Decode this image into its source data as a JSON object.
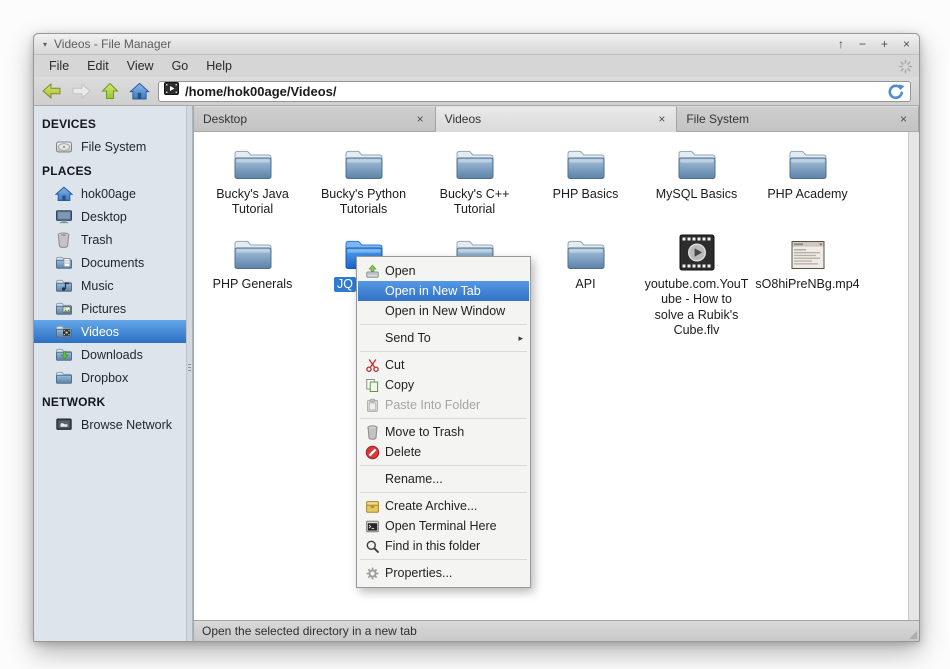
{
  "window": {
    "title": "Videos - File Manager",
    "controls": [
      {
        "name": "roll-up",
        "glyph": "↑"
      },
      {
        "name": "minimize",
        "glyph": "−"
      },
      {
        "name": "maximize",
        "glyph": "+"
      },
      {
        "name": "close",
        "glyph": "×"
      }
    ],
    "title_dropdown_glyph": "▾"
  },
  "menubar": {
    "items": [
      "File",
      "Edit",
      "View",
      "Go",
      "Help"
    ]
  },
  "toolbar": {
    "path": "/home/hok00age/Videos/"
  },
  "tabs": [
    {
      "label": "Desktop",
      "active": false,
      "close_glyph": "×"
    },
    {
      "label": "Videos",
      "active": true,
      "close_glyph": "×"
    },
    {
      "label": "File System",
      "active": false,
      "close_glyph": "×"
    }
  ],
  "sidebar": {
    "sections": [
      {
        "header": "DEVICES",
        "items": [
          {
            "label": "File System",
            "icon": "drive-icon"
          }
        ]
      },
      {
        "header": "PLACES",
        "items": [
          {
            "label": "hok00age",
            "icon": "home-icon"
          },
          {
            "label": "Desktop",
            "icon": "desktop-icon"
          },
          {
            "label": "Trash",
            "icon": "trash-icon"
          },
          {
            "label": "Documents",
            "icon": "documents-folder-icon"
          },
          {
            "label": "Music",
            "icon": "music-folder-icon"
          },
          {
            "label": "Pictures",
            "icon": "pictures-folder-icon"
          },
          {
            "label": "Videos",
            "icon": "videos-folder-icon",
            "selected": true
          },
          {
            "label": "Downloads",
            "icon": "downloads-folder-icon"
          },
          {
            "label": "Dropbox",
            "icon": "folder-icon"
          }
        ]
      },
      {
        "header": "NETWORK",
        "items": [
          {
            "label": "Browse Network",
            "icon": "network-icon"
          }
        ]
      }
    ]
  },
  "files": {
    "items": [
      {
        "label": "Bucky's Java\nTutorial",
        "icon": "folder-large-icon"
      },
      {
        "label": "Bucky's Python\nTutorials",
        "icon": "folder-large-icon"
      },
      {
        "label": "Bucky's C++\nTutorial",
        "icon": "folder-large-icon"
      },
      {
        "label": "PHP Basics",
        "icon": "folder-large-icon"
      },
      {
        "label": "MySQL Basics",
        "icon": "folder-large-icon"
      },
      {
        "label": "PHP Academy",
        "icon": "folder-large-icon"
      },
      {
        "label": "PHP Generals",
        "icon": "folder-large-icon"
      },
      {
        "label": "JQ",
        "icon": "folder-selected-icon",
        "selected": true,
        "label_align": "left",
        "label_truncated_by_menu": true
      },
      {
        "label": "",
        "icon": "folder-large-icon"
      },
      {
        "label": "API",
        "icon": "folder-large-icon"
      },
      {
        "label": "youtube.com.YouT\nube - How to\nsolve a Rubik's\nCube.flv",
        "icon": "film-video-icon"
      },
      {
        "label": "sO8hiPreNBg.mp4",
        "icon": "window-video-icon"
      }
    ]
  },
  "context_menu": {
    "items": [
      {
        "label": "Open",
        "icon": "open-icon"
      },
      {
        "label": "Open in New Tab",
        "highlighted": true
      },
      {
        "label": "Open in New Window"
      },
      {
        "separator": true
      },
      {
        "label": "Send To",
        "submenu": true,
        "submenu_glyph": "▸"
      },
      {
        "separator": true
      },
      {
        "label": "Cut",
        "icon": "cut-icon"
      },
      {
        "label": "Copy",
        "icon": "copy-icon"
      },
      {
        "label": "Paste Into Folder",
        "icon": "paste-icon",
        "disabled": true
      },
      {
        "separator": true
      },
      {
        "label": "Move to Trash",
        "icon": "trash-small-icon"
      },
      {
        "label": "Delete",
        "icon": "delete-icon"
      },
      {
        "separator": true
      },
      {
        "label": "Rename..."
      },
      {
        "separator": true
      },
      {
        "label": "Create Archive...",
        "icon": "archive-icon"
      },
      {
        "label": "Open Terminal Here",
        "icon": "terminal-icon"
      },
      {
        "label": "Find in this folder",
        "icon": "find-icon"
      },
      {
        "separator": true
      },
      {
        "label": "Properties...",
        "icon": "properties-icon"
      }
    ]
  },
  "statusbar": {
    "text": "Open the selected directory in a new tab"
  },
  "colors": {
    "selection_blue": "#3376c8",
    "menu_highlight": "#4489d8",
    "sidebar_bg": "#dde4ec",
    "folder_blue": "#6f94b5",
    "selected_folder_blue": "#2a7ade",
    "chrome_gray": "#d6d6d6"
  }
}
